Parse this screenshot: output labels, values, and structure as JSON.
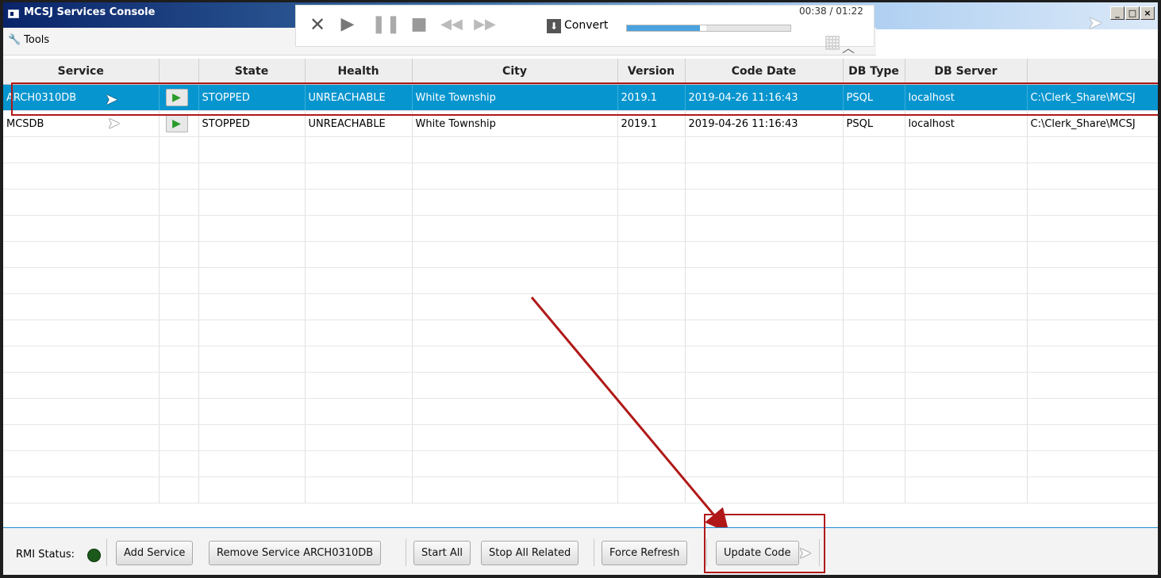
{
  "window": {
    "title": "MCSJ Services Console",
    "min": "_",
    "max": "□",
    "close": "×"
  },
  "menu": {
    "tools": "Tools"
  },
  "media_player": {
    "convert": "Convert",
    "time": "00:38 / 01:22",
    "progress": 0.46
  },
  "table": {
    "headers": [
      "Service",
      "",
      "State",
      "Health",
      "City",
      "Version",
      "Code Date",
      "DB Type",
      "DB Server",
      ""
    ],
    "rows": [
      {
        "service": "ARCH0310DB",
        "state": "STOPPED",
        "health": "UNREACHABLE",
        "city": "White Township",
        "version": "2019.1",
        "code_date": "2019-04-26 11:16:43",
        "db_type": "PSQL",
        "db_server": "localhost",
        "path": "C:\\Clerk_Share\\MCSJ"
      },
      {
        "service": "MCSDB",
        "state": "STOPPED",
        "health": "UNREACHABLE",
        "city": "White Township",
        "version": "2019.1",
        "code_date": "2019-04-26 11:16:43",
        "db_type": "PSQL",
        "db_server": "localhost",
        "path": "C:\\Clerk_Share\\MCSJ"
      }
    ],
    "empty_rows": 14
  },
  "bottom": {
    "rmi_label": "RMI Status:",
    "add_service": "Add Service",
    "remove_service": "Remove Service ARCH0310DB",
    "start_all": "Start All",
    "stop_all_related": "Stop All Related",
    "force_refresh": "Force Refresh",
    "update_code": "Update Code"
  },
  "colors": {
    "selection": "#0795cf",
    "annotation": "#b01818",
    "play": "#2a9b2a",
    "rmi_status": "#1c5a1c"
  }
}
